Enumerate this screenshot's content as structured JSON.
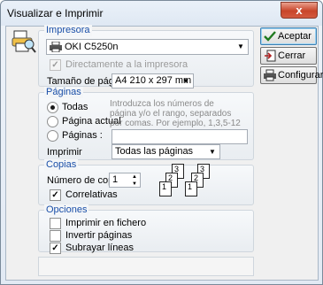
{
  "window": {
    "title": "Visualizar e Imprimir",
    "close_label": "x"
  },
  "printer_group": {
    "legend": "Impresora",
    "printer_value": "OKI C5250n",
    "direct_label": "Directamente a la impresora",
    "direct_checked": true,
    "direct_disabled": true,
    "page_size_label": "Tamaño de página",
    "page_size_value": "A4 210 x 297 mm"
  },
  "pages_group": {
    "legend": "Páginas",
    "all_label": "Todas",
    "current_label": "Página actual",
    "pages_label": "Páginas :",
    "pages_input_value": "",
    "hint_lines": [
      "Introduzca los números de",
      "página y/o el rango, separados",
      "por comas. Por ejemplo, 1,3,5-12"
    ],
    "print_label": "Imprimir",
    "print_value": "Todas las páginas",
    "selected": "all"
  },
  "copies_group": {
    "legend": "Copias",
    "count_label": "Número de copias",
    "count_value": "1",
    "collate_label": "Correlativas",
    "collate_checked": true,
    "stack_numbers": [
      "1",
      "2",
      "3"
    ]
  },
  "options_group": {
    "legend": "Opciones",
    "to_file_label": "Imprimir en fichero",
    "to_file_checked": false,
    "reverse_label": "Invertir páginas",
    "reverse_checked": false,
    "underline_label": "Subrayar líneas",
    "underline_checked": true
  },
  "buttons": {
    "accept": "Aceptar",
    "close": "Cerrar",
    "configure": "Configurar"
  },
  "colors": {
    "legend": "#1a4fa8",
    "accent": "#3c7fb1"
  }
}
